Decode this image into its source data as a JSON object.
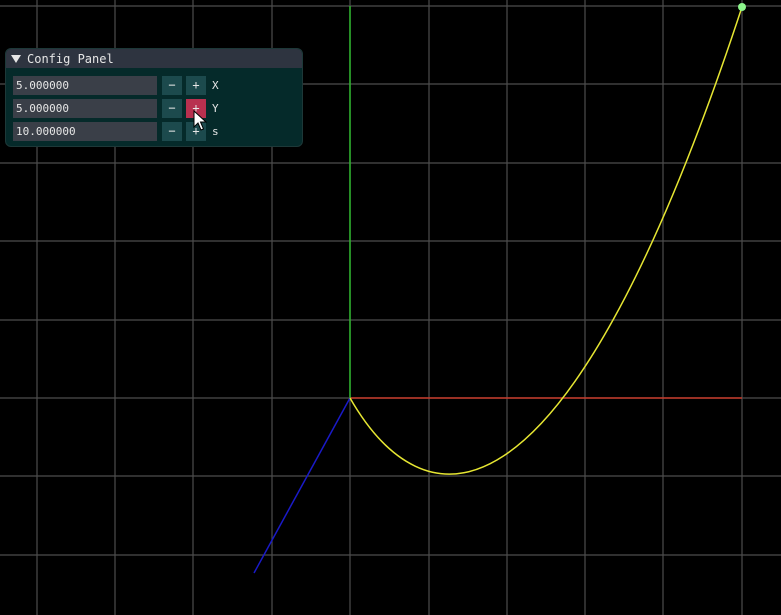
{
  "panel": {
    "title": "Config Panel",
    "rows": [
      {
        "value": "5.000000",
        "minus": "−",
        "plus": "+",
        "label": "X"
      },
      {
        "value": "5.000000",
        "minus": "−",
        "plus": "+",
        "label": "Y"
      },
      {
        "value": "10.000000",
        "minus": "−",
        "plus": "+",
        "label": "s"
      }
    ]
  },
  "colors": {
    "background": "#000000",
    "grid": "#4d4d4d",
    "axis_x": "#c83a2a",
    "axis_y": "#2fb82f",
    "axis_z": "#1a1ac8",
    "curve": "#e6e632",
    "endpoint": "#8cf58c",
    "panel_bg": "#052a2a",
    "title_bar": "#2e3440",
    "button": "#1c4a4d",
    "button_active": "#b8304f"
  },
  "icons": {
    "collapse": "triangle-down-icon",
    "cursor": "mouse-pointer-icon"
  }
}
